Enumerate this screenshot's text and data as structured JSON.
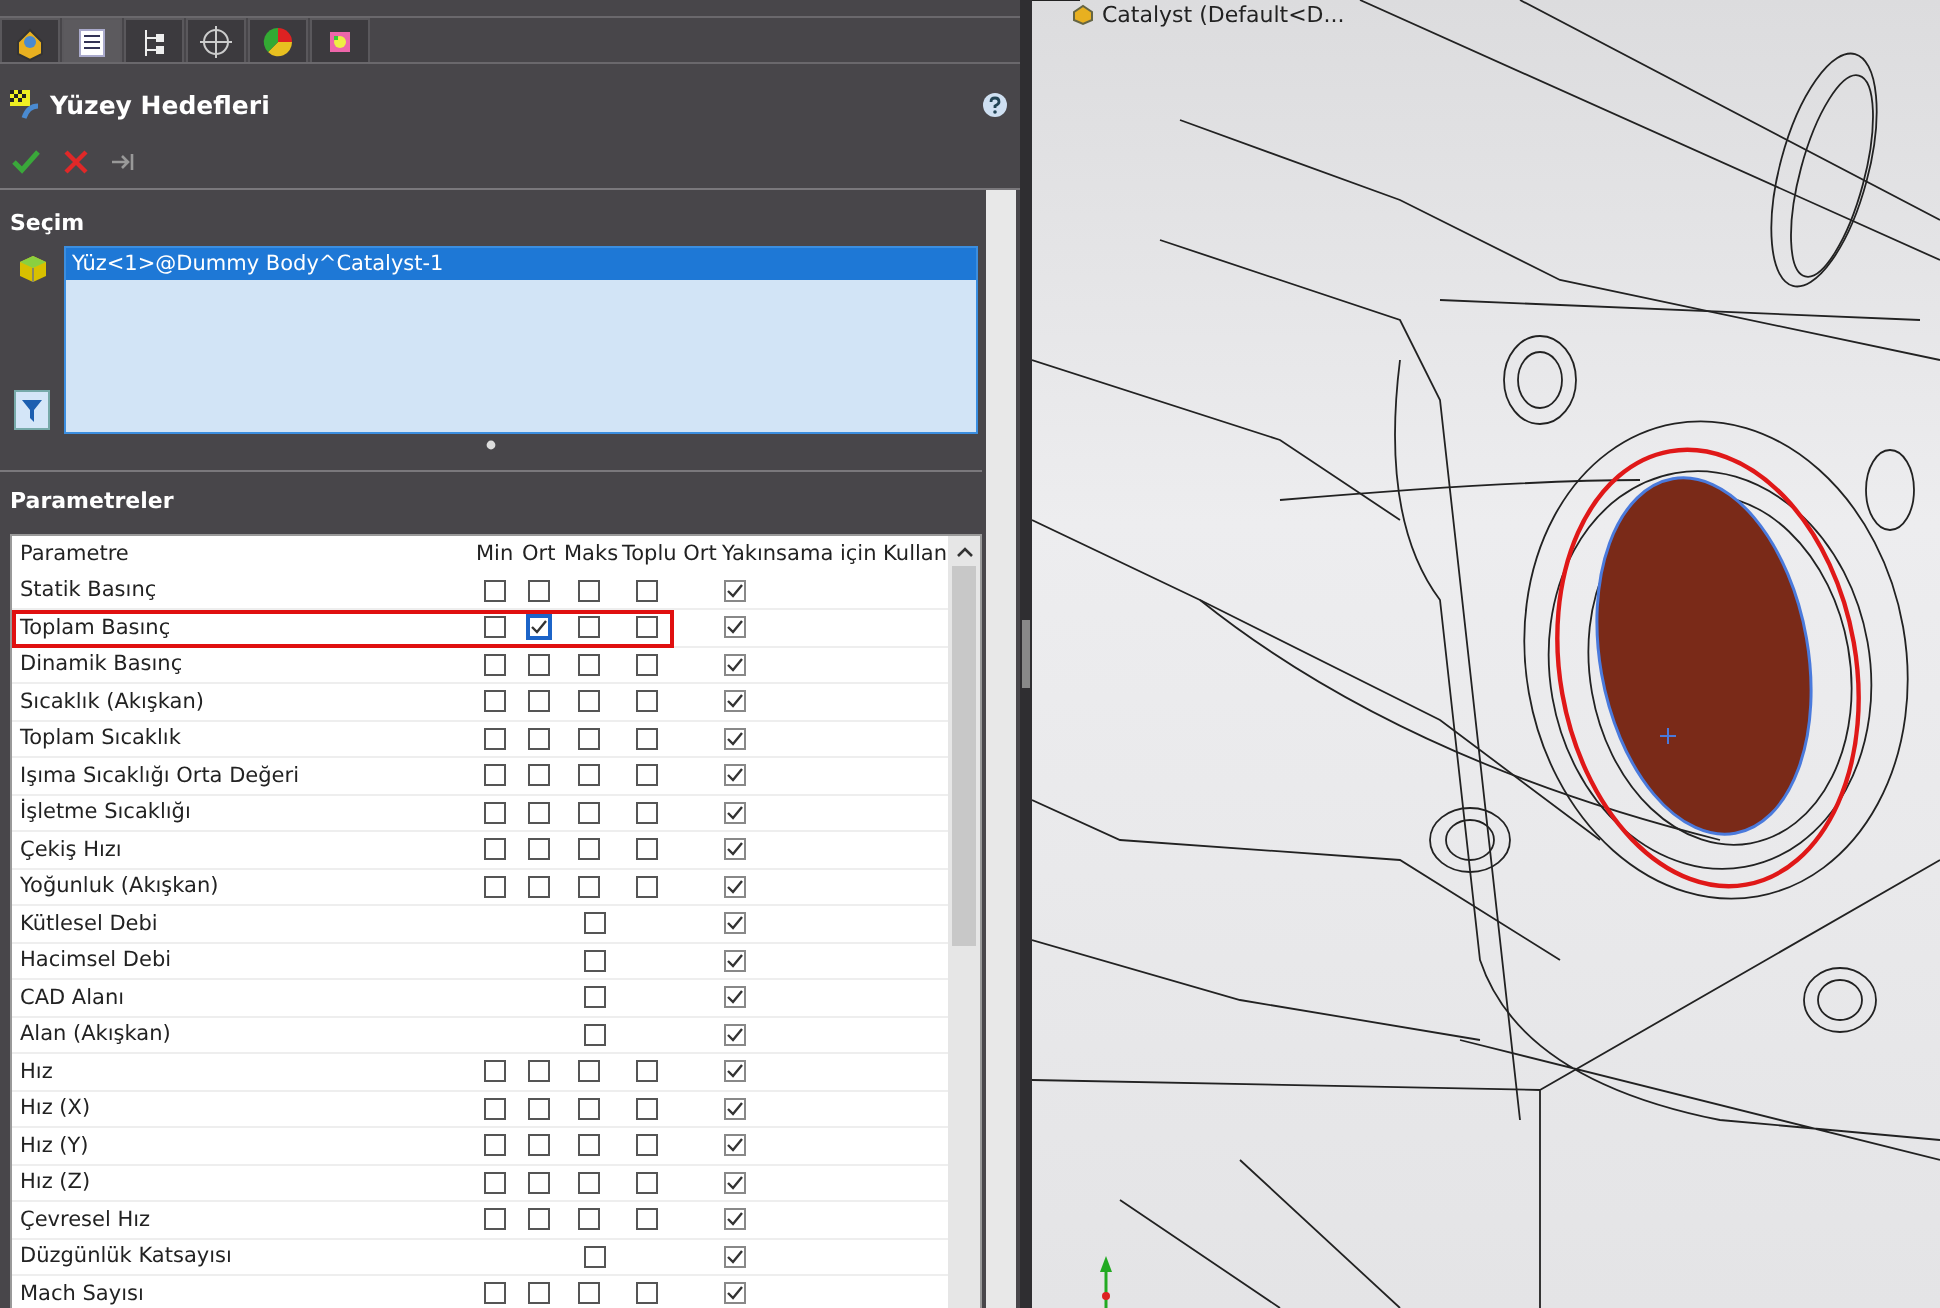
{
  "tabs": [
    {
      "kind": "part",
      "selected": false
    },
    {
      "kind": "property",
      "selected": true
    },
    {
      "kind": "config",
      "selected": false
    },
    {
      "kind": "dim",
      "selected": false
    },
    {
      "kind": "display",
      "selected": false
    },
    {
      "kind": "flow",
      "selected": false
    }
  ],
  "panel": {
    "title": "Yüzey Hedefleri"
  },
  "selection": {
    "heading": "Seçim",
    "items": [
      {
        "label": "Yüz<1>@Dummy Body^Catalyst-1",
        "selected": true
      }
    ]
  },
  "parameters": {
    "heading": "Parametreler",
    "columns": [
      "Parametre",
      "Min",
      "Ort",
      "Maks",
      "Toplu Ort",
      "Yakınsama için Kullan"
    ],
    "rows": [
      {
        "name": "Statik Basınç",
        "kind": "full",
        "min": false,
        "ort": false,
        "maks": false,
        "toplu_ort": false,
        "converge": true,
        "highlighted": false
      },
      {
        "name": "Toplam Basınç",
        "kind": "full",
        "min": false,
        "ort": true,
        "maks": false,
        "toplu_ort": false,
        "converge": true,
        "highlighted": true
      },
      {
        "name": "Dinamik Basınç",
        "kind": "full",
        "min": false,
        "ort": false,
        "maks": false,
        "toplu_ort": false,
        "converge": true,
        "highlighted": false
      },
      {
        "name": "Sıcaklık (Akışkan)",
        "kind": "full",
        "min": false,
        "ort": false,
        "maks": false,
        "toplu_ort": false,
        "converge": true,
        "highlighted": false
      },
      {
        "name": "Toplam Sıcaklık",
        "kind": "full",
        "min": false,
        "ort": false,
        "maks": false,
        "toplu_ort": false,
        "converge": true,
        "highlighted": false
      },
      {
        "name": "Işıma Sıcaklığı Orta Değeri",
        "kind": "full",
        "min": false,
        "ort": false,
        "maks": false,
        "toplu_ort": false,
        "converge": true,
        "highlighted": false
      },
      {
        "name": "İşletme Sıcaklığı",
        "kind": "full",
        "min": false,
        "ort": false,
        "maks": false,
        "toplu_ort": false,
        "converge": true,
        "highlighted": false
      },
      {
        "name": "Çekiş Hızı",
        "kind": "full",
        "min": false,
        "ort": false,
        "maks": false,
        "toplu_ort": false,
        "converge": true,
        "highlighted": false
      },
      {
        "name": "Yoğunluk (Akışkan)",
        "kind": "full",
        "min": false,
        "ort": false,
        "maks": false,
        "toplu_ort": false,
        "converge": true,
        "highlighted": false
      },
      {
        "name": "Kütlesel Debi",
        "kind": "single",
        "value": false,
        "converge": true,
        "highlighted": false
      },
      {
        "name": "Hacimsel Debi",
        "kind": "single",
        "value": false,
        "converge": true,
        "highlighted": false
      },
      {
        "name": "CAD Alanı",
        "kind": "single",
        "value": false,
        "converge": true,
        "highlighted": false
      },
      {
        "name": "Alan (Akışkan)",
        "kind": "single",
        "value": false,
        "converge": true,
        "highlighted": false
      },
      {
        "name": "Hız",
        "kind": "full",
        "min": false,
        "ort": false,
        "maks": false,
        "toplu_ort": false,
        "converge": true,
        "highlighted": false
      },
      {
        "name": "Hız (X)",
        "kind": "full",
        "min": false,
        "ort": false,
        "maks": false,
        "toplu_ort": false,
        "converge": true,
        "highlighted": false
      },
      {
        "name": "Hız (Y)",
        "kind": "full",
        "min": false,
        "ort": false,
        "maks": false,
        "toplu_ort": false,
        "converge": true,
        "highlighted": false
      },
      {
        "name": "Hız (Z)",
        "kind": "full",
        "min": false,
        "ort": false,
        "maks": false,
        "toplu_ort": false,
        "converge": true,
        "highlighted": false
      },
      {
        "name": "Çevresel Hız",
        "kind": "full",
        "min": false,
        "ort": false,
        "maks": false,
        "toplu_ort": false,
        "converge": true,
        "highlighted": false
      },
      {
        "name": "Düzgünlük Katsayısı",
        "kind": "single",
        "value": false,
        "converge": true,
        "highlighted": false
      },
      {
        "name": "Mach Sayısı",
        "kind": "full",
        "min": false,
        "ort": false,
        "maks": false,
        "toplu_ort": false,
        "converge": true,
        "highlighted": false
      }
    ]
  },
  "viewport": {
    "tree_label": "Catalyst  (Default<D..."
  }
}
